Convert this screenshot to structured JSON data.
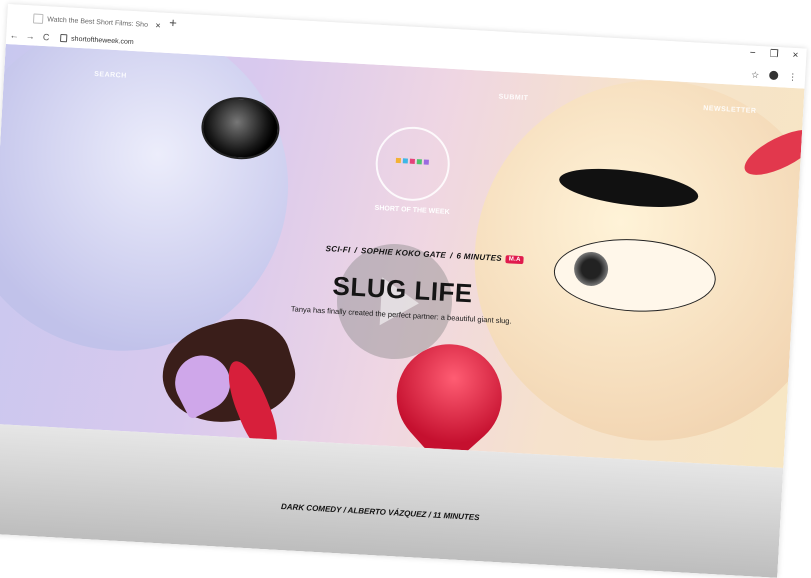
{
  "browser": {
    "tab_title": "Watch the Best Short Films: Sho",
    "tab_close": "×",
    "new_tab": "+",
    "url": "shortoftheweek.com",
    "back": "←",
    "forward": "→",
    "reload": "C",
    "star": "☆",
    "menu": "⋮",
    "minimize": "−",
    "maximize": "❐",
    "close": "×"
  },
  "nav": {
    "left": "SEARCH",
    "center": "SUBMIT",
    "right": "NEWSLETTER"
  },
  "badge": {
    "label": "SHORT OF THE WEEK",
    "colors": [
      "#f3b234",
      "#3fb7e6",
      "#e5427a",
      "#4fc36e",
      "#9b6be0"
    ]
  },
  "hero": {
    "genre": "SCI-FI",
    "director": "SOPHIE KOKO GATE",
    "duration": "6 MINUTES",
    "separator": "/",
    "rating": "M.A",
    "title": "SLUG LIFE",
    "description": "Tanya has finally created the perfect partner: a beautiful giant slug."
  },
  "next": {
    "meta": "DARK COMEDY  /  ALBERTO VÁZQUEZ  /  11 MINUTES"
  }
}
